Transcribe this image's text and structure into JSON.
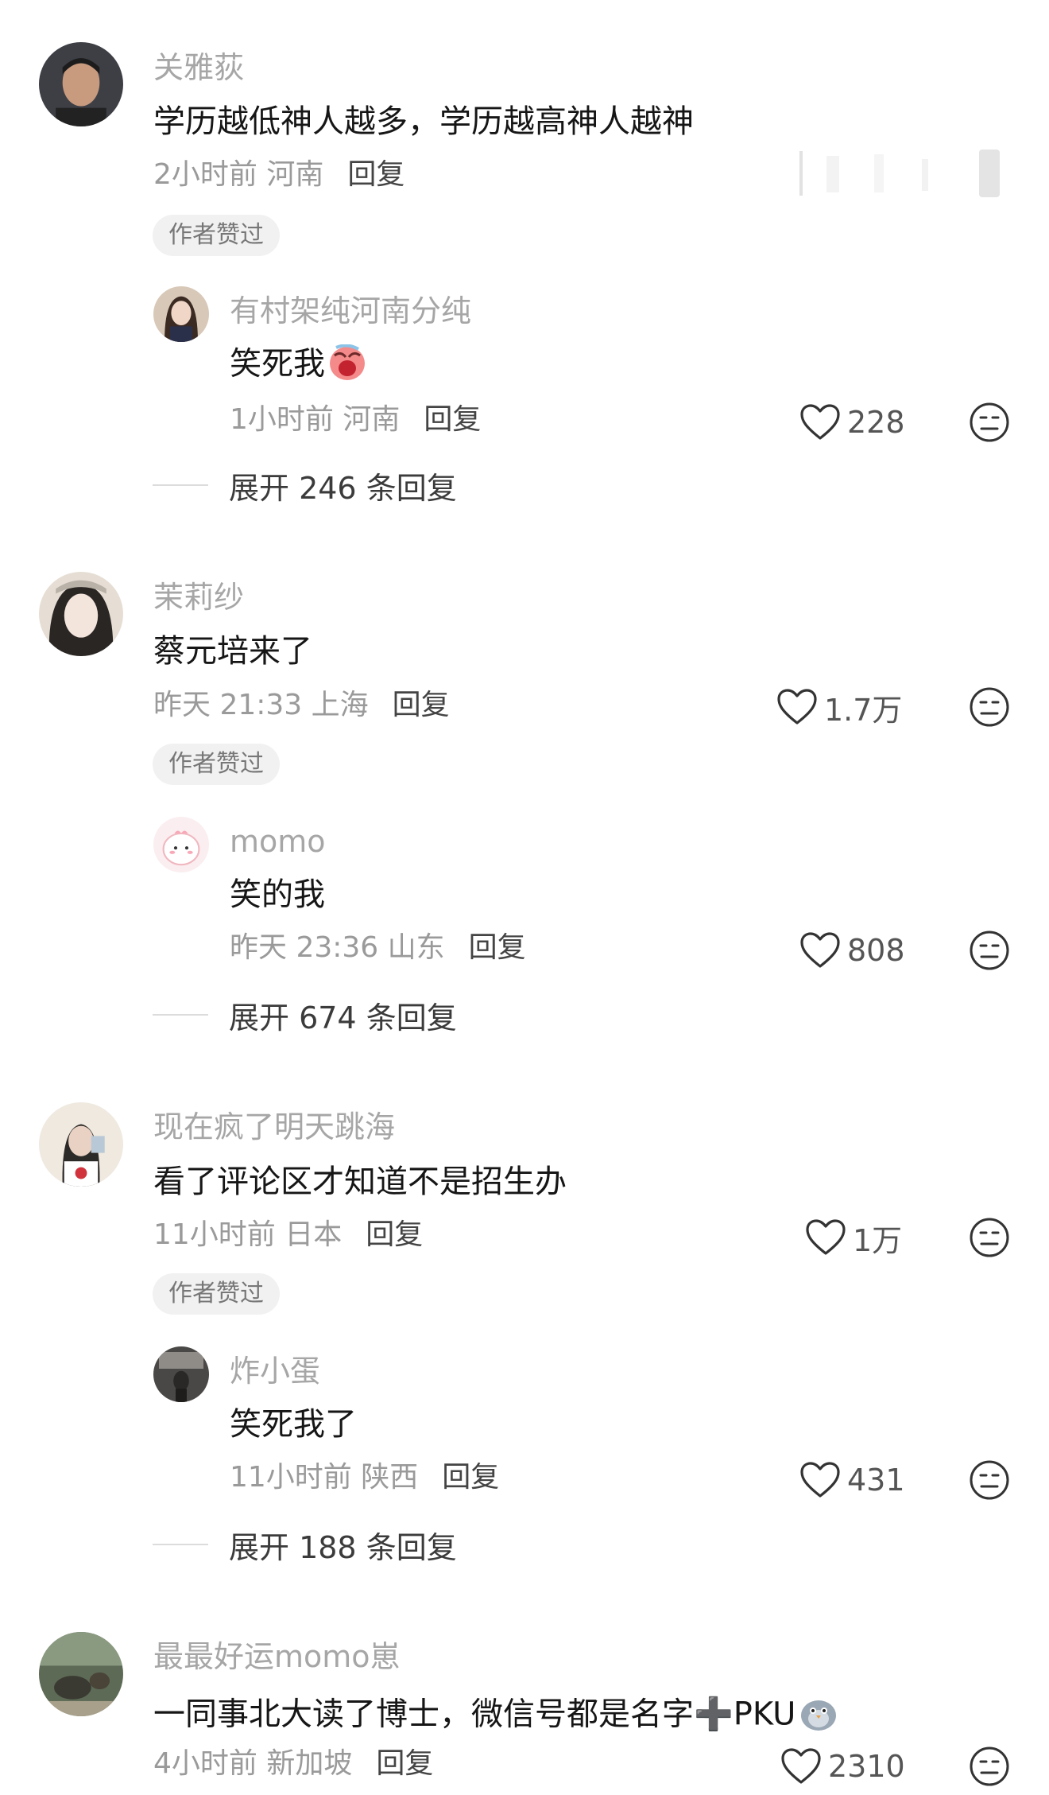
{
  "comments": [
    {
      "name": "关雅荻",
      "text": "学历越低神人越多，学历越高神人越神",
      "meta": "2小时前 河南",
      "reply_label": "回复",
      "author_liked": "作者赞过",
      "reply": {
        "name": "有村架纯河南分纯",
        "text": "笑死我",
        "emoji": "crying-face-emoji",
        "meta": "1小时前 河南",
        "reply_label": "回复",
        "likes": "228"
      },
      "expand": "展开 246 条回复"
    },
    {
      "name": "茉莉纱",
      "text": "蔡元培来了",
      "meta": "昨天 21:33 上海",
      "reply_label": "回复",
      "likes": "1.7万",
      "author_liked": "作者赞过",
      "reply": {
        "name": "momo",
        "text": "笑的我",
        "meta": "昨天 23:36 山东",
        "reply_label": "回复",
        "likes": "808"
      },
      "expand": "展开 674 条回复"
    },
    {
      "name": "现在疯了明天跳海",
      "text": "看了评论区才知道不是招生办",
      "meta": "11小时前 日本",
      "reply_label": "回复",
      "likes": "1万",
      "author_liked": "作者赞过",
      "reply": {
        "name": "炸小蛋",
        "text": "笑死我了",
        "meta": "11小时前 陕西",
        "reply_label": "回复",
        "likes": "431"
      },
      "expand": "展开 188 条回复"
    },
    {
      "name": "最最好运momo崽",
      "text": "一同事北大读了博士，微信号都是名字➕PKU",
      "emoji": "pigeon-emoji",
      "meta": "4小时前 新加坡",
      "reply_label": "回复",
      "likes": "2310"
    }
  ],
  "icons": {
    "like": "heart-outline-icon",
    "dislike": "meh-face-icon"
  },
  "colors": {
    "name": "#a6a6a6",
    "text": "#161616",
    "meta": "#9a9a9a",
    "badge_bg": "#f1f1f1"
  }
}
